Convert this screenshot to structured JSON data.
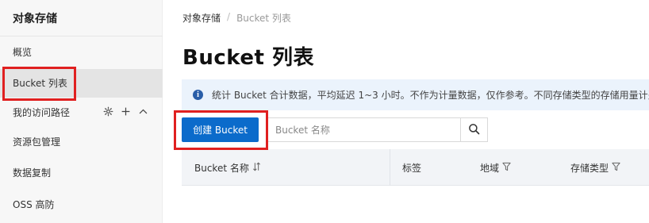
{
  "sidebar": {
    "title": "对象存储",
    "items": [
      {
        "label": "概览"
      },
      {
        "label": "Bucket 列表"
      },
      {
        "label": "我的访问路径"
      },
      {
        "label": "资源包管理"
      },
      {
        "label": "数据复制"
      },
      {
        "label": "OSS 高防"
      }
    ],
    "route_icons": [
      "gear-icon",
      "plus-icon",
      "chevron-up-icon"
    ]
  },
  "breadcrumb": {
    "parent": "对象存储",
    "separator": "/",
    "current": "Bucket 列表"
  },
  "page": {
    "title": "Bucket 列表"
  },
  "info_bar": {
    "icon": "info-icon",
    "text": "统计 Bucket 合计数据，平均延迟 1~3 小时。不作为计量数据，仅作参考。不同存储类型的存储用量计费"
  },
  "toolbar": {
    "create_label": "创建 Bucket",
    "search_placeholder": "Bucket 名称"
  },
  "table": {
    "columns": [
      {
        "label": "Bucket 名称",
        "icon": "sort-icon"
      },
      {
        "label": "标签"
      },
      {
        "label": "地域",
        "icon": "filter-icon"
      },
      {
        "label": "存储类型",
        "icon": "filter-icon"
      }
    ]
  },
  "colors": {
    "primary": "#0b6bcb",
    "info_bg": "#ebf3fc",
    "highlight_box": "#e02020",
    "sidebar_bg": "#f7f7f7"
  }
}
